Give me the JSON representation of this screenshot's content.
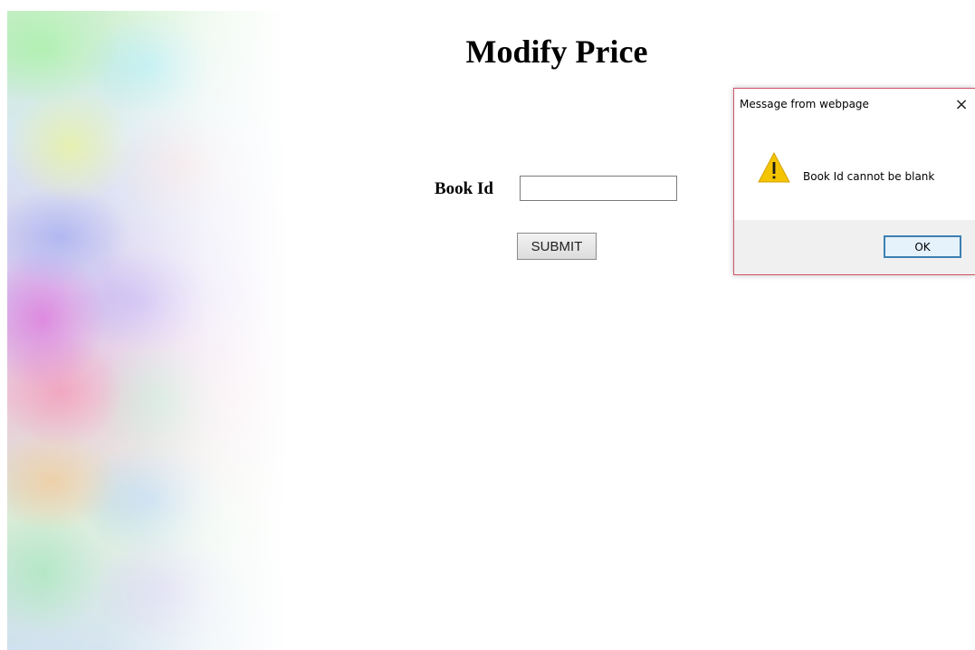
{
  "page": {
    "title": "Modify Price"
  },
  "form": {
    "book_id_label": "Book Id",
    "book_id_value": "",
    "submit_label": "SUBMIT"
  },
  "dialog": {
    "title": "Message from webpage",
    "close_glyph": "×",
    "icon": "warning-icon",
    "message": "Book Id cannot be blank",
    "ok_label": "OK"
  },
  "colors": {
    "dialog_border": "#d0546a",
    "ok_border": "#3c7fb1",
    "warning_fill": "#f5c400"
  }
}
